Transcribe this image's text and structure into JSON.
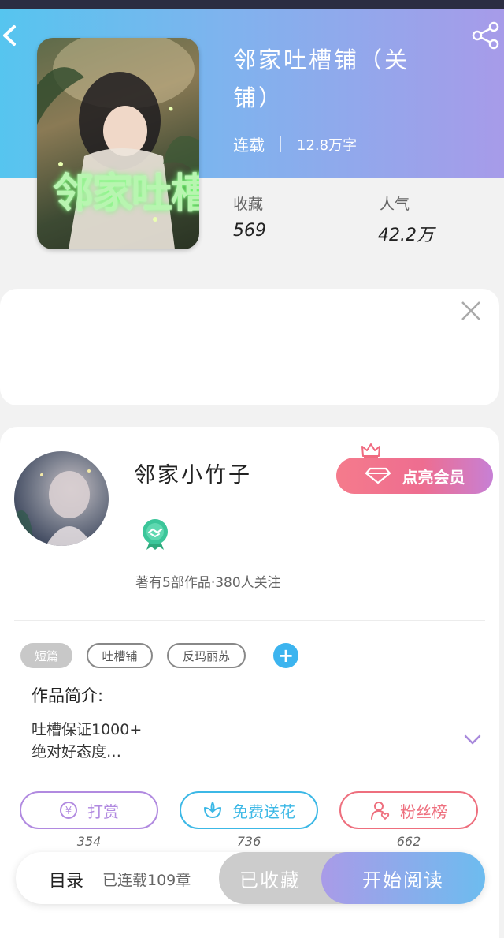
{
  "header": {
    "back_icon": "chevron-left-icon",
    "share_icon": "share-icon"
  },
  "book": {
    "title_line1": "邻家吐槽铺（关",
    "title_line2": "铺）",
    "status": "连载",
    "word_count": "12.8万字",
    "cover_text": "邻家吐槽铺",
    "stats": {
      "favorites_label": "收藏",
      "favorites_value": "569",
      "popularity_label": "人气",
      "popularity_value": "42.2万"
    }
  },
  "ad": {
    "close_icon": "close-icon"
  },
  "author": {
    "name": "邻家小竹子",
    "stats": "著有5部作品·380人关注",
    "badge_icon": "handshake-badge-icon",
    "vip_button": "点亮会员"
  },
  "tags": [
    "短篇",
    "吐槽铺",
    "反玛丽苏"
  ],
  "intro": {
    "label": "作品简介:",
    "line1": "吐槽保证1000+",
    "line2": "绝对好态度…"
  },
  "actions": [
    {
      "label": "打赏",
      "count": "354",
      "color": "#b18ae0",
      "icon": "yen-coin-icon"
    },
    {
      "label": "免费送花",
      "count": "736",
      "color": "#3cb8e6",
      "icon": "flower-icon"
    },
    {
      "label": "粉丝榜",
      "count": "662",
      "color": "#ee6f7e",
      "icon": "fan-user-icon"
    }
  ],
  "bottom_bar": {
    "toc_label": "目录",
    "chapters": "已连载109章",
    "favorited_label": "已收藏",
    "read_label": "开始阅读"
  },
  "colors": {
    "hero_start": "#56c5ef",
    "hero_end": "#a79be9",
    "vip_pink": "#f57b8c",
    "accent_blue": "#3cb4ef"
  }
}
